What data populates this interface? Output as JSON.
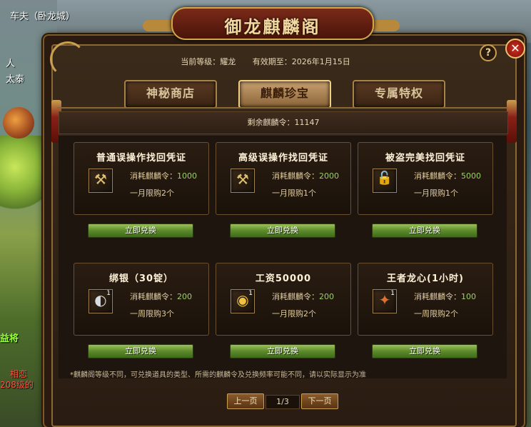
{
  "hud": {
    "player_name": "车夫（卧龙城）",
    "side_texts": [
      "人",
      "太泰"
    ],
    "green_text": "益将",
    "red_texts": [
      "相恋",
      "208级的"
    ]
  },
  "dialog": {
    "title": "御龙麒麟阁",
    "help_label": "?",
    "close_label": "✕",
    "level_label": "当前等级：耀龙",
    "expire_label": "有效期至：2026年1月15日",
    "remaining_label": "剩余麒麟令：11147",
    "tabs": [
      {
        "label": "神秘商店",
        "active": false
      },
      {
        "label": "麒麟珍宝",
        "active": true
      },
      {
        "label": "专属特权",
        "active": false
      }
    ],
    "items": [
      {
        "title": "普通误操作找回凭证",
        "icon": "hammer-voucher-icon",
        "glyph": "⚒",
        "qty": "",
        "cost_label": "消耗麒麟令：",
        "cost": "1000",
        "limit": "一月限购2个",
        "button": "立即兑换"
      },
      {
        "title": "高级误操作找回凭证",
        "icon": "hammer-voucher-icon",
        "glyph": "⚒",
        "qty": "",
        "cost_label": "消耗麒麟令：",
        "cost": "2000",
        "limit": "一月限购1个",
        "button": "立即兑换"
      },
      {
        "title": "被盗完美找回凭证",
        "icon": "lock-chest-icon",
        "glyph": "🔓",
        "qty": "",
        "cost_label": "消耗麒麟令：",
        "cost": "5000",
        "limit": "一月限购1个",
        "button": "立即兑换"
      },
      {
        "title": "绑银（30锭）",
        "icon": "silver-ingot-icon",
        "glyph": "◐",
        "qty": "1",
        "cost_label": "消耗麒麟令：",
        "cost": "200",
        "limit": "一周限购3个",
        "button": "立即兑换"
      },
      {
        "title": "工资50000",
        "icon": "gold-coins-icon",
        "glyph": "◉",
        "qty": "1",
        "cost_label": "消耗麒麟令：",
        "cost": "200",
        "limit": "一月限购2个",
        "button": "立即兑换"
      },
      {
        "title": "王者龙心(1小时)",
        "icon": "dragon-heart-icon",
        "glyph": "✦",
        "qty": "1",
        "cost_label": "消耗麒麟令：",
        "cost": "100",
        "limit": "一周限购2个",
        "button": "立即兑换"
      }
    ],
    "note": "*麒麟阁等级不同，可兑换道具的类型、所需的麒麟令及兑换频率可能不同，请以实际显示为准",
    "pagination": {
      "prev": "上一页",
      "page": "1/3",
      "next": "下一页"
    }
  },
  "colors": {
    "frame_gold": "#c8a050",
    "button_green": "#5c8a2a",
    "cost_green": "#9ad06a"
  }
}
